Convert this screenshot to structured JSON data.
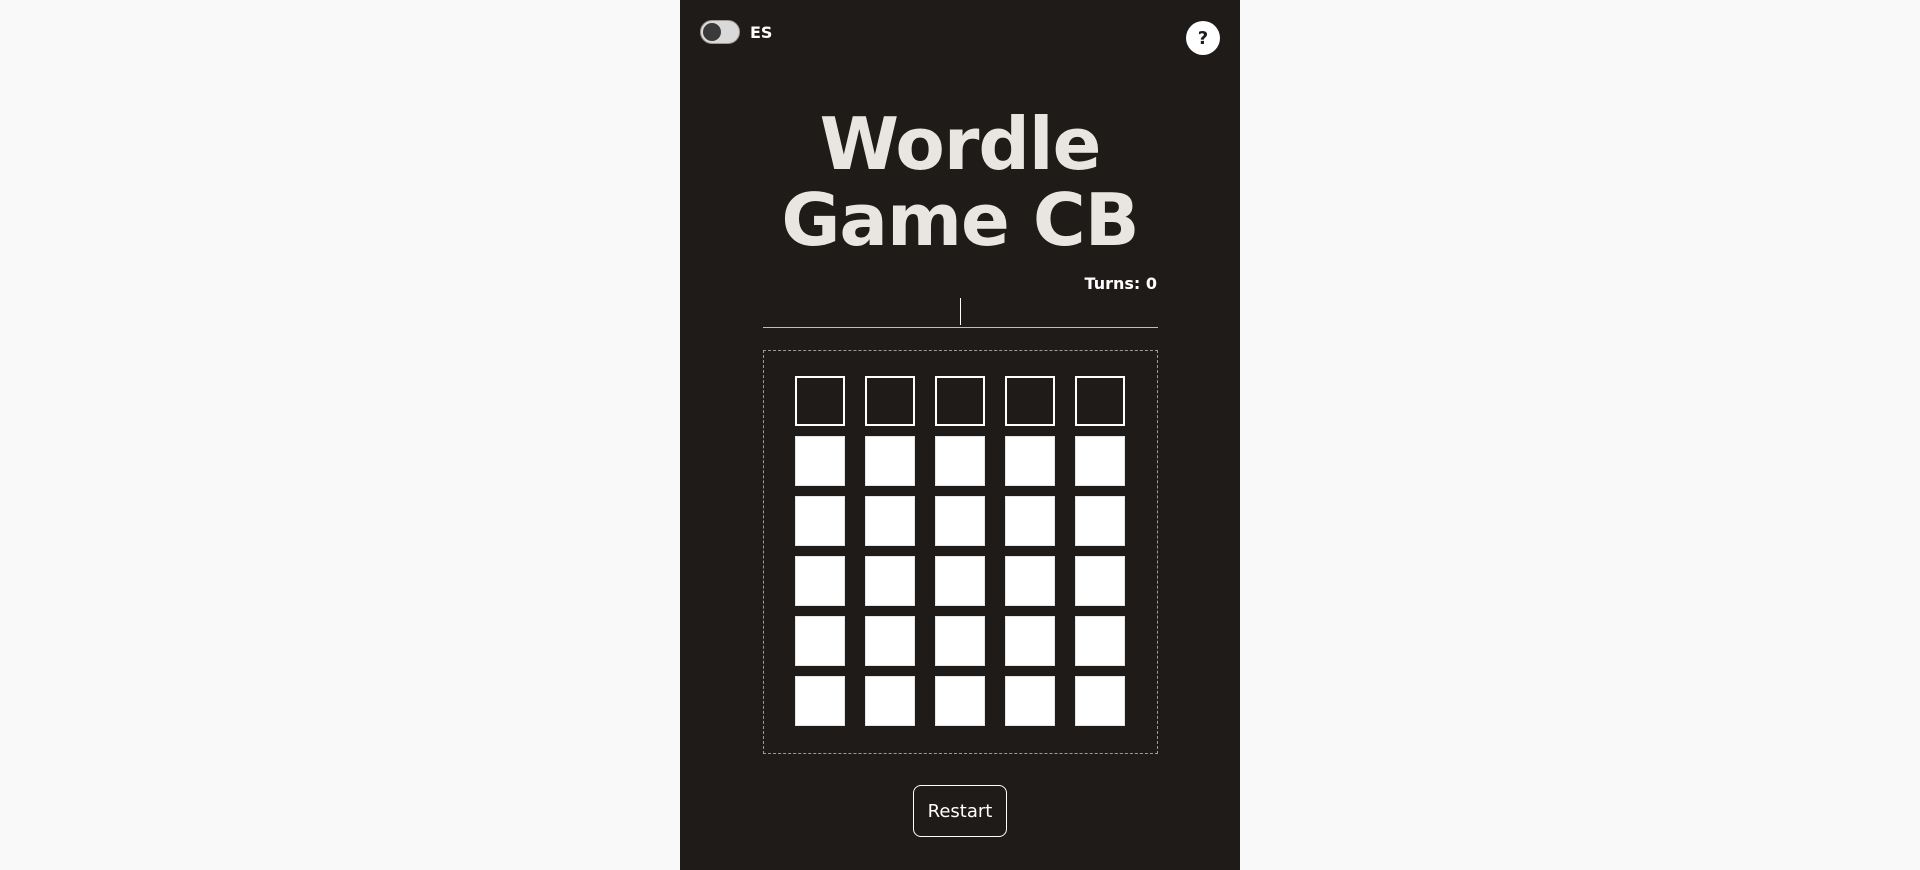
{
  "header": {
    "language_label": "ES",
    "help_label": "?"
  },
  "title": {
    "line1": "Wordle",
    "line2": "Game CB"
  },
  "status": {
    "turns_text": "Turns: 0"
  },
  "input": {
    "value": ""
  },
  "board": {
    "rows": 6,
    "columns": 5,
    "active_row": 1
  },
  "actions": {
    "restart_label": "Restart"
  },
  "colors": {
    "panel_background": "#1f1b18",
    "page_background": "#f9f9f9",
    "title_text": "#e9e6e2",
    "tile_fill": "#ffffff"
  }
}
